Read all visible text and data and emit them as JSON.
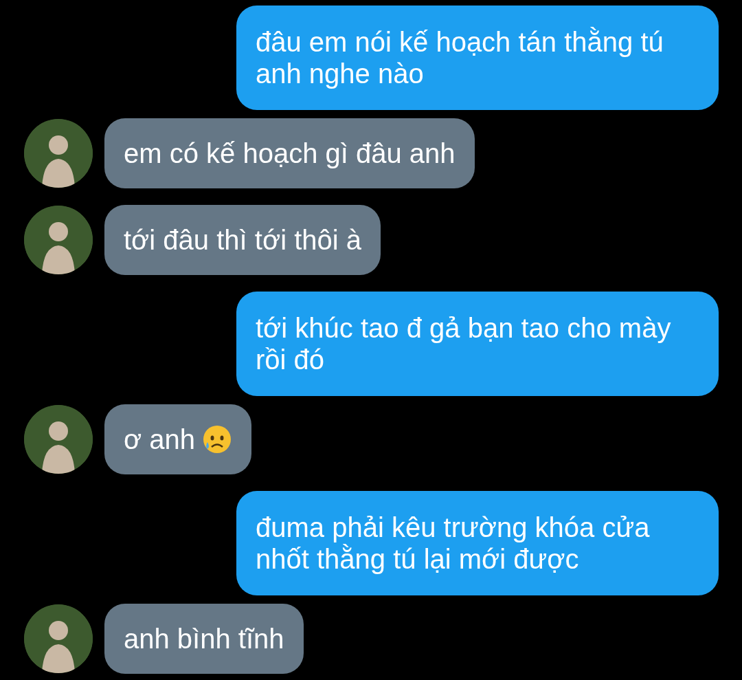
{
  "messages": [
    {
      "kind": "sent",
      "text": "đâu em nói kế hoạch tán thằng tú anh nghe nào"
    },
    {
      "kind": "received",
      "text": "em có kế hoạch gì đâu anh"
    },
    {
      "kind": "received",
      "text": "tới đâu thì tới thôi à"
    },
    {
      "kind": "sent",
      "text": "tới khúc tao đ gả bạn tao cho mày rồi đó"
    },
    {
      "kind": "received",
      "text": "ơ anh",
      "trailing_emoji": true
    },
    {
      "kind": "sent",
      "text": "đuma phải kêu trường khóa cửa nhốt thằng tú lại mới được"
    },
    {
      "kind": "received",
      "text": "anh bình tĩnh"
    }
  ]
}
